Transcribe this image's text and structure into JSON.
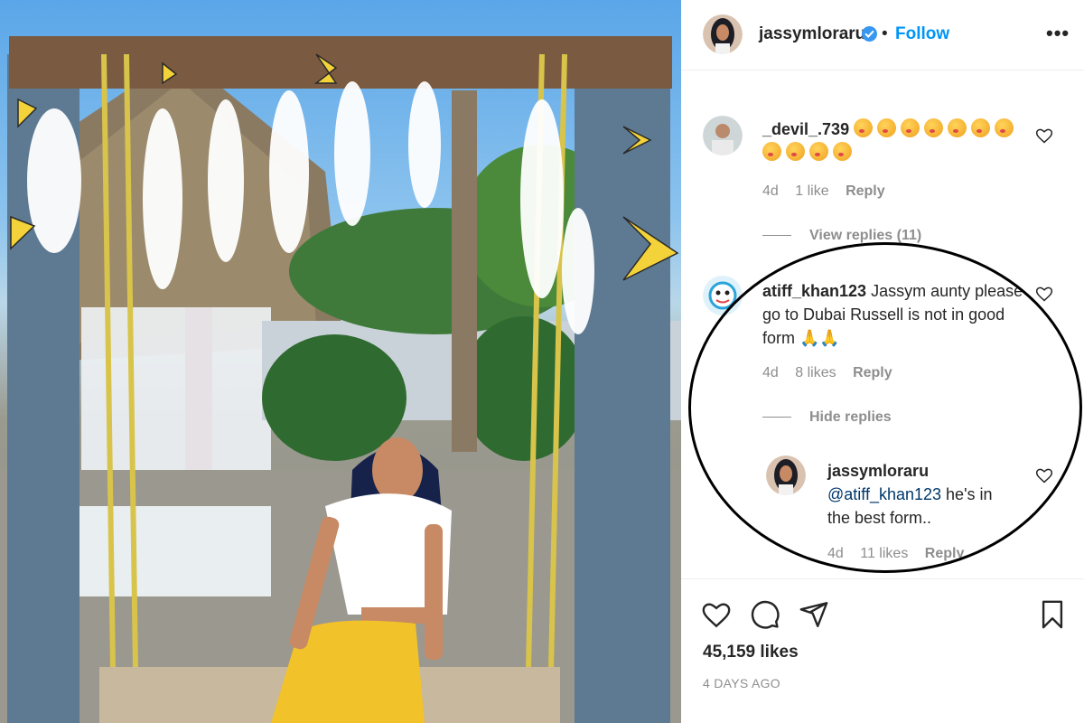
{
  "post": {
    "username": "jassymloraru",
    "verified": true,
    "separator": "•",
    "follow_label": "Follow",
    "more_label": "•••"
  },
  "comments": [
    {
      "username": "_devil_.739",
      "text": "",
      "emoji_count": 11,
      "age": "4d",
      "likes": "1 like",
      "reply_label": "Reply",
      "view_replies": "View replies (11)"
    },
    {
      "username": "atiff_khan123",
      "text_line1": "Jassym aunty please",
      "text_line2": "go to Dubai Russell is not in good",
      "text_line3": "form 🙏🙏",
      "age": "4d",
      "likes": "8 likes",
      "reply_label": "Reply",
      "hide_replies": "Hide replies"
    }
  ],
  "reply": {
    "username": "jassymloraru",
    "mention": "@atiff_khan123",
    "text_line1": " he's in",
    "text_line2": "the best form..",
    "age": "4d",
    "likes": "11 likes",
    "reply_label": "Reply"
  },
  "stats": {
    "likes": "45,159 likes",
    "date": "4 DAYS AGO"
  },
  "colors": {
    "accent": "#0095f6",
    "muted": "#8e8e8e",
    "text": "#262626",
    "pants": "#f2c22a",
    "butterfly": "#f3d23a",
    "post_wood": "#5e7a93"
  },
  "icons": [
    "verified-badge-icon",
    "more-options-icon",
    "heart-icon",
    "comment-icon",
    "share-icon",
    "bookmark-icon"
  ]
}
